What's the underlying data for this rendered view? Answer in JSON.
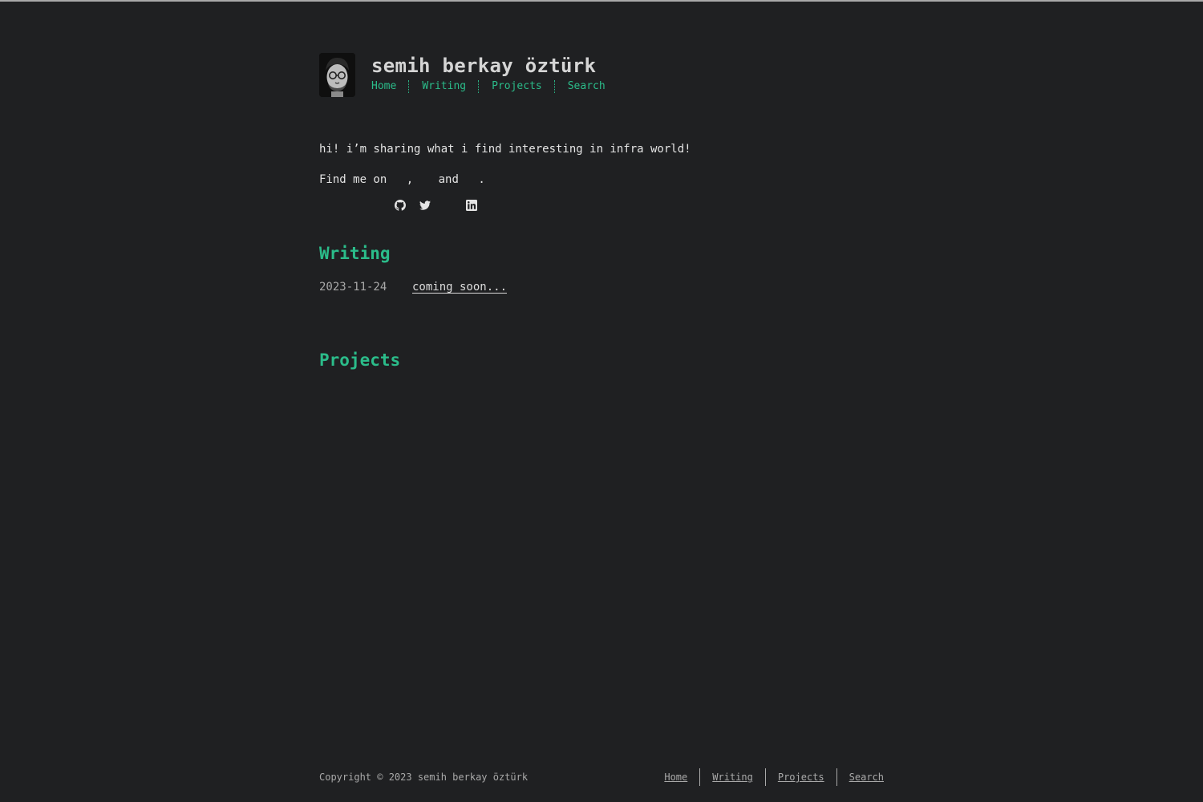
{
  "header": {
    "site_title": "semih berkay öztürk",
    "avatar_alt": "profile photo"
  },
  "nav": {
    "items": [
      {
        "label": "Home"
      },
      {
        "label": "Writing"
      },
      {
        "label": "Projects"
      },
      {
        "label": "Search"
      }
    ]
  },
  "intro": {
    "text": "hi! i’m sharing what i find interesting in infra world!",
    "findme_prefix": "Find me on ",
    "findme_comma": ",",
    "findme_and": " and ",
    "findme_period": ".",
    "icons": [
      "github-icon",
      "twitter-icon",
      "linkedin-icon"
    ]
  },
  "writing": {
    "title": "Writing",
    "posts": [
      {
        "date": "2023-11-24",
        "title": "coming soon..."
      }
    ]
  },
  "projects": {
    "title": "Projects"
  },
  "footer": {
    "copyright": "Copyright © 2023 semih berkay öztürk",
    "nav": [
      {
        "label": "Home"
      },
      {
        "label": "Writing"
      },
      {
        "label": "Projects"
      },
      {
        "label": "Search"
      }
    ]
  },
  "colors": {
    "background": "#1f2022",
    "accent": "#2bbc8a",
    "text": "#dcdcdc",
    "muted": "#a9a9a9"
  }
}
